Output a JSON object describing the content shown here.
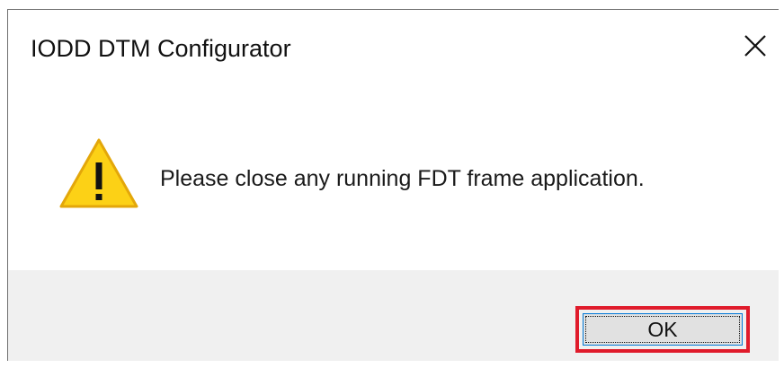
{
  "dialog": {
    "title": "IODD DTM Configurator",
    "close_icon": "close-icon",
    "warning_icon": "warning-triangle-icon",
    "message": "Please close any running FDT frame application.",
    "ok_label": "OK"
  },
  "colors": {
    "warning_fill": "#fcd116",
    "warning_stroke": "#e3a70a",
    "highlight": "#e01b2b",
    "footer_bg": "#f0f0f0",
    "button_bg": "#e1e1e1",
    "button_border": "#0078d7"
  }
}
